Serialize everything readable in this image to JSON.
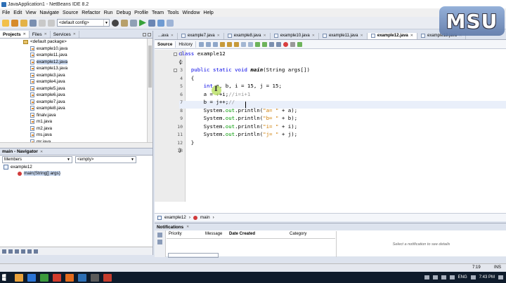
{
  "window": {
    "title": "JavaApplication1 - NetBeans IDE 8.2"
  },
  "menu": [
    "File",
    "Edit",
    "View",
    "Navigate",
    "Source",
    "Refactor",
    "Run",
    "Debug",
    "Profile",
    "Team",
    "Tools",
    "Window",
    "Help"
  ],
  "toolbar": {
    "config_value": "<default config>"
  },
  "projects_panel": {
    "tabs": [
      {
        "label": "Projects"
      },
      {
        "label": "Files"
      },
      {
        "label": "Services"
      }
    ],
    "tree": [
      {
        "label": "<default package>",
        "kind": "package"
      },
      {
        "label": "example10.java",
        "kind": "file"
      },
      {
        "label": "example11.java",
        "kind": "file"
      },
      {
        "label": "example12.java",
        "kind": "file",
        "selected": true
      },
      {
        "label": "example13.java",
        "kind": "file"
      },
      {
        "label": "example3.java",
        "kind": "file"
      },
      {
        "label": "example4.java",
        "kind": "file"
      },
      {
        "label": "example5.java",
        "kind": "file"
      },
      {
        "label": "example6.java",
        "kind": "file"
      },
      {
        "label": "example7.java",
        "kind": "file"
      },
      {
        "label": "example8.java",
        "kind": "file"
      },
      {
        "label": "finalv.java",
        "kind": "file"
      },
      {
        "label": "m1.java",
        "kind": "file"
      },
      {
        "label": "m2.java",
        "kind": "file"
      },
      {
        "label": "ms.java",
        "kind": "file"
      },
      {
        "label": "mr.java",
        "kind": "file"
      }
    ]
  },
  "navigator": {
    "title": "main - Navigator",
    "filter_value": "Members",
    "scope_value": "<empty>",
    "class_label": "example12",
    "method_label": "main(String[] args)"
  },
  "editor": {
    "tabs": [
      {
        "label": "...ava"
      },
      {
        "label": "example7.java"
      },
      {
        "label": "example8.java"
      },
      {
        "label": "example10.java"
      },
      {
        "label": "example11.java"
      },
      {
        "label": "example12.java",
        "active": true
      },
      {
        "label": "example13.java"
      }
    ],
    "source_label": "Source",
    "history_label": "History",
    "line_numbers": [
      "1",
      "2",
      "3",
      "4",
      "5",
      "6",
      "7",
      "8",
      "9",
      "10",
      "11",
      "12",
      "13"
    ],
    "breadcrumb": {
      "class_label": "example12",
      "method_label": "main"
    }
  },
  "notifications": {
    "title": "Notifications",
    "columns": [
      "Priority",
      "Message",
      "Date Created",
      "Category"
    ],
    "detail_placeholder": "Select a notification to see details"
  },
  "status": {
    "position": "7:19",
    "mode": "INS"
  },
  "taskbar": {
    "language": "ENG",
    "time": "7:43 PM"
  },
  "logo_text": "MSU"
}
